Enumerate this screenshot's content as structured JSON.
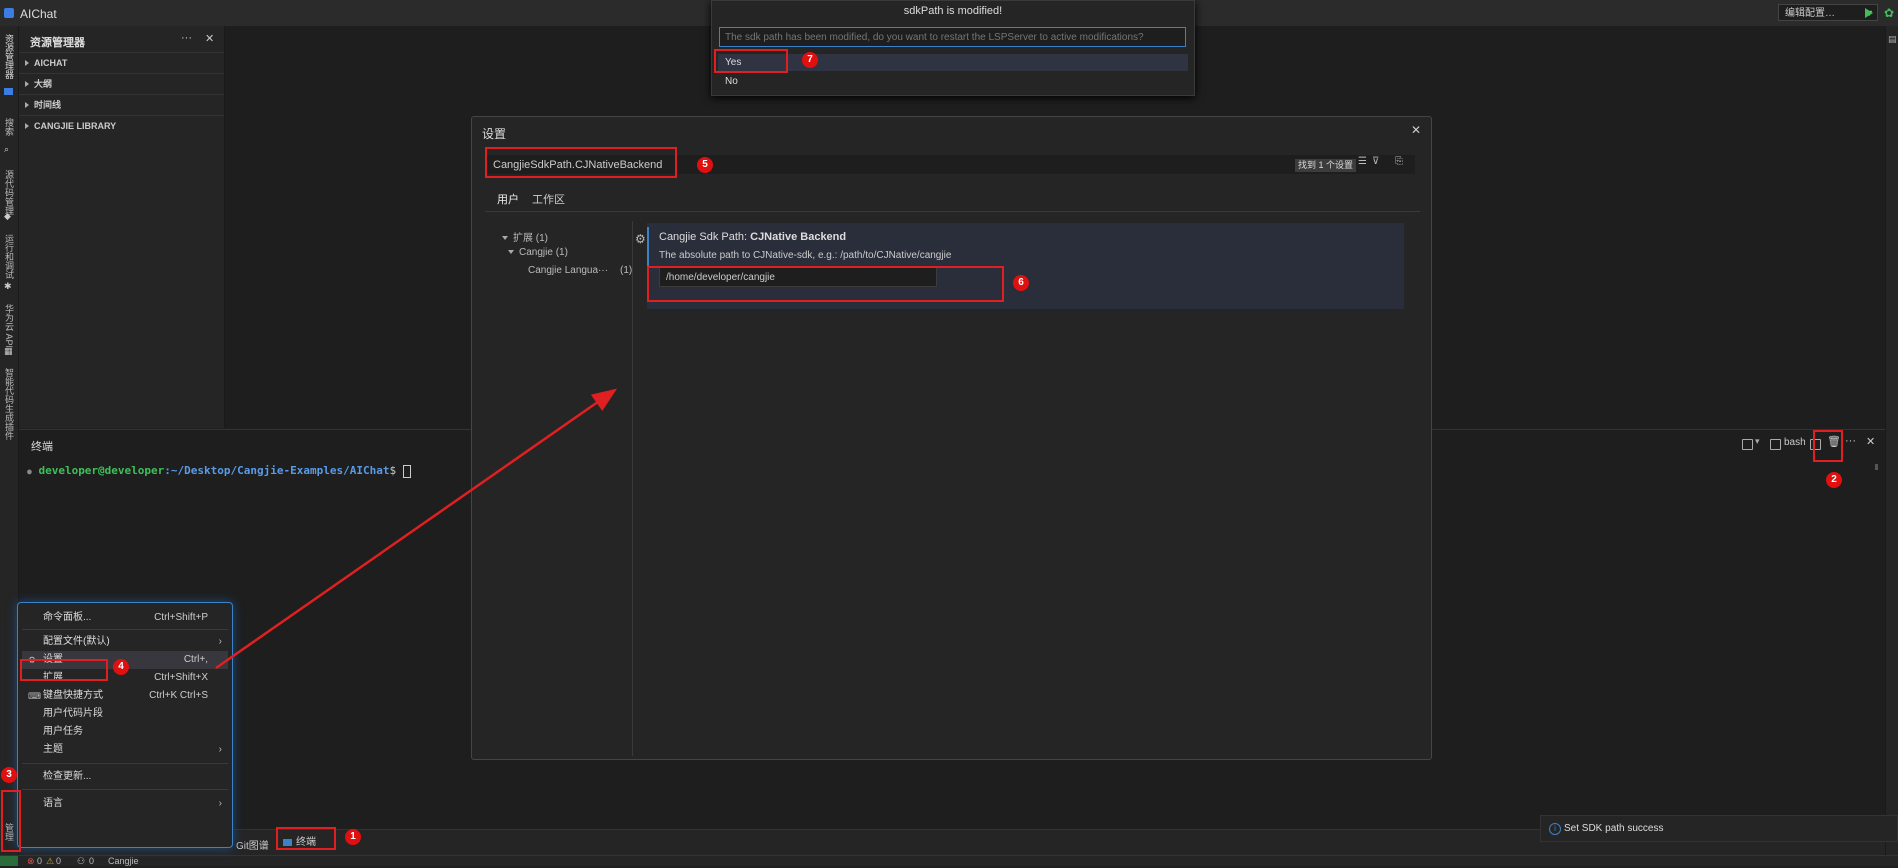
{
  "window": {
    "app_title": "AIChat",
    "run_config": "编辑配置…"
  },
  "activity_bar": {
    "labels": [
      "资源管理器",
      "搜索",
      "源代码管理",
      "运行和调试",
      "华为云 API",
      "智能代码生成插件",
      "管理"
    ]
  },
  "explorer": {
    "title": "资源管理器",
    "sections": [
      "AICHAT",
      "大纲",
      "时间线",
      "CANGJIE LIBRARY"
    ]
  },
  "terminal": {
    "title": "终端",
    "prompt_user": "developer@developer",
    "prompt_path": ":~/Desktop/Cangjie-Examples/AIChat",
    "prompt_suffix": "$",
    "shell_label": "bash"
  },
  "panel_tabs": {
    "git_graph": "Git图谱",
    "terminal": "终端"
  },
  "status_bar": {
    "errors": "0",
    "warnings": "0",
    "ports": "0",
    "language": "Cangjie"
  },
  "quick_pick": {
    "title": "sdkPath is modified!",
    "prompt": "The sdk path has been modified, do you want to restart the LSPServer to active modifications?",
    "options": [
      "Yes",
      "No"
    ]
  },
  "settings": {
    "title": "设置",
    "search_value": "CangjieSdkPath.CJNativeBackend",
    "found_text": "找到 1 个设置",
    "tabs": [
      "用户",
      "工作区"
    ],
    "tree": [
      {
        "label": "扩展 (1)"
      },
      {
        "label": "Cangjie (1)"
      },
      {
        "label": "Cangjie Langua···",
        "count": "(1)"
      }
    ],
    "item": {
      "name_prefix": "Cangjie Sdk Path: ",
      "name_bold": "CJNative Backend",
      "description": "The absolute path to CJNative-sdk, e.g.: /path/to/CJNative/cangjie",
      "value": "/home/developer/cangjie"
    }
  },
  "context_menu": {
    "items": [
      {
        "label": "命令面板...",
        "key": "Ctrl+Shift+P"
      },
      {
        "label": "配置文件(默认)",
        "key": ""
      },
      {
        "label": "设置",
        "key": "Ctrl+,"
      },
      {
        "label": "扩展",
        "key": "Ctrl+Shift+X"
      },
      {
        "label": "键盘快捷方式",
        "key": "Ctrl+K Ctrl+S"
      },
      {
        "label": "用户代码片段",
        "key": ""
      },
      {
        "label": "用户任务",
        "key": ""
      },
      {
        "label": "主题",
        "key": ""
      },
      {
        "label": "检查更新...",
        "key": ""
      },
      {
        "label": "语言",
        "key": ""
      }
    ]
  },
  "notification": {
    "message": "Set SDK path success"
  },
  "annotations": [
    "1",
    "2",
    "3",
    "4",
    "5",
    "6",
    "7"
  ],
  "colors": {
    "accent": "#3b82c6",
    "annotation_red": "#e02020",
    "prompt_green": "#3fbf5a",
    "prompt_blue": "#5a9be8"
  }
}
